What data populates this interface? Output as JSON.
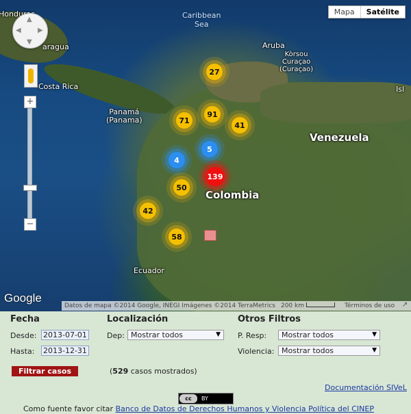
{
  "map": {
    "map_type_options": [
      "Mapa",
      "Satélite"
    ],
    "selected_map_type": "Satélite",
    "labels": {
      "honduras": "Honduras",
      "nicaragua": "aragua",
      "costa_rica": "Costa Rica",
      "caribbean_sea": "Caribbean\nSea",
      "aruba": "Aruba",
      "korsou": "Kòrsou\nCuraçao\n(Curaçao)",
      "panama": "Panamá\n(Panama)",
      "venezuela": "Venezuela",
      "colombia": "Colombia",
      "ecuador": "Ecuador",
      "isla": "Isl"
    },
    "clusters": [
      {
        "count": "27",
        "color": "yellow"
      },
      {
        "count": "71",
        "color": "yellow"
      },
      {
        "count": "91",
        "color": "yellow"
      },
      {
        "count": "41",
        "color": "yellow"
      },
      {
        "count": "5",
        "color": "blue"
      },
      {
        "count": "4",
        "color": "blue"
      },
      {
        "count": "139",
        "color": "red"
      },
      {
        "count": "50",
        "color": "yellow"
      },
      {
        "count": "42",
        "color": "yellow"
      },
      {
        "count": "58",
        "color": "yellow"
      }
    ],
    "google_logo": "Google",
    "attribution": "Datos de mapa ©2014 Google, INEGI Imágenes ©2014 TerraMetrics",
    "scale_label": "200 km",
    "terms": "Términos de uso",
    "zoom_in": "+",
    "zoom_out": "−"
  },
  "filters": {
    "fecha": {
      "title": "Fecha",
      "desde_label": "Desde:",
      "desde_value": "2013-07-01",
      "hasta_label": "Hasta:",
      "hasta_value": "2013-12-31"
    },
    "localizacion": {
      "title": "Localización",
      "dep_label": "Dep:",
      "dep_value": "Mostrar todos"
    },
    "otros": {
      "title": "Otros Filtros",
      "resp_label": "P. Resp:",
      "resp_value": "Mostrar todos",
      "violencia_label": "Violencia:",
      "violencia_value": "Mostrar todos"
    },
    "filter_button": "Filtrar casos",
    "shown_count": "529",
    "shown_open": "(",
    "shown_suffix": " casos mostrados)"
  },
  "footer": {
    "doc_link": "Documentación SIVeL",
    "cc_badge": "cc",
    "cc_by": "BY",
    "citation_prefix": "Como fuente favor citar ",
    "citation_link": "Banco de Datos de Derechos Humanos y Violencia Política del CINEP"
  }
}
